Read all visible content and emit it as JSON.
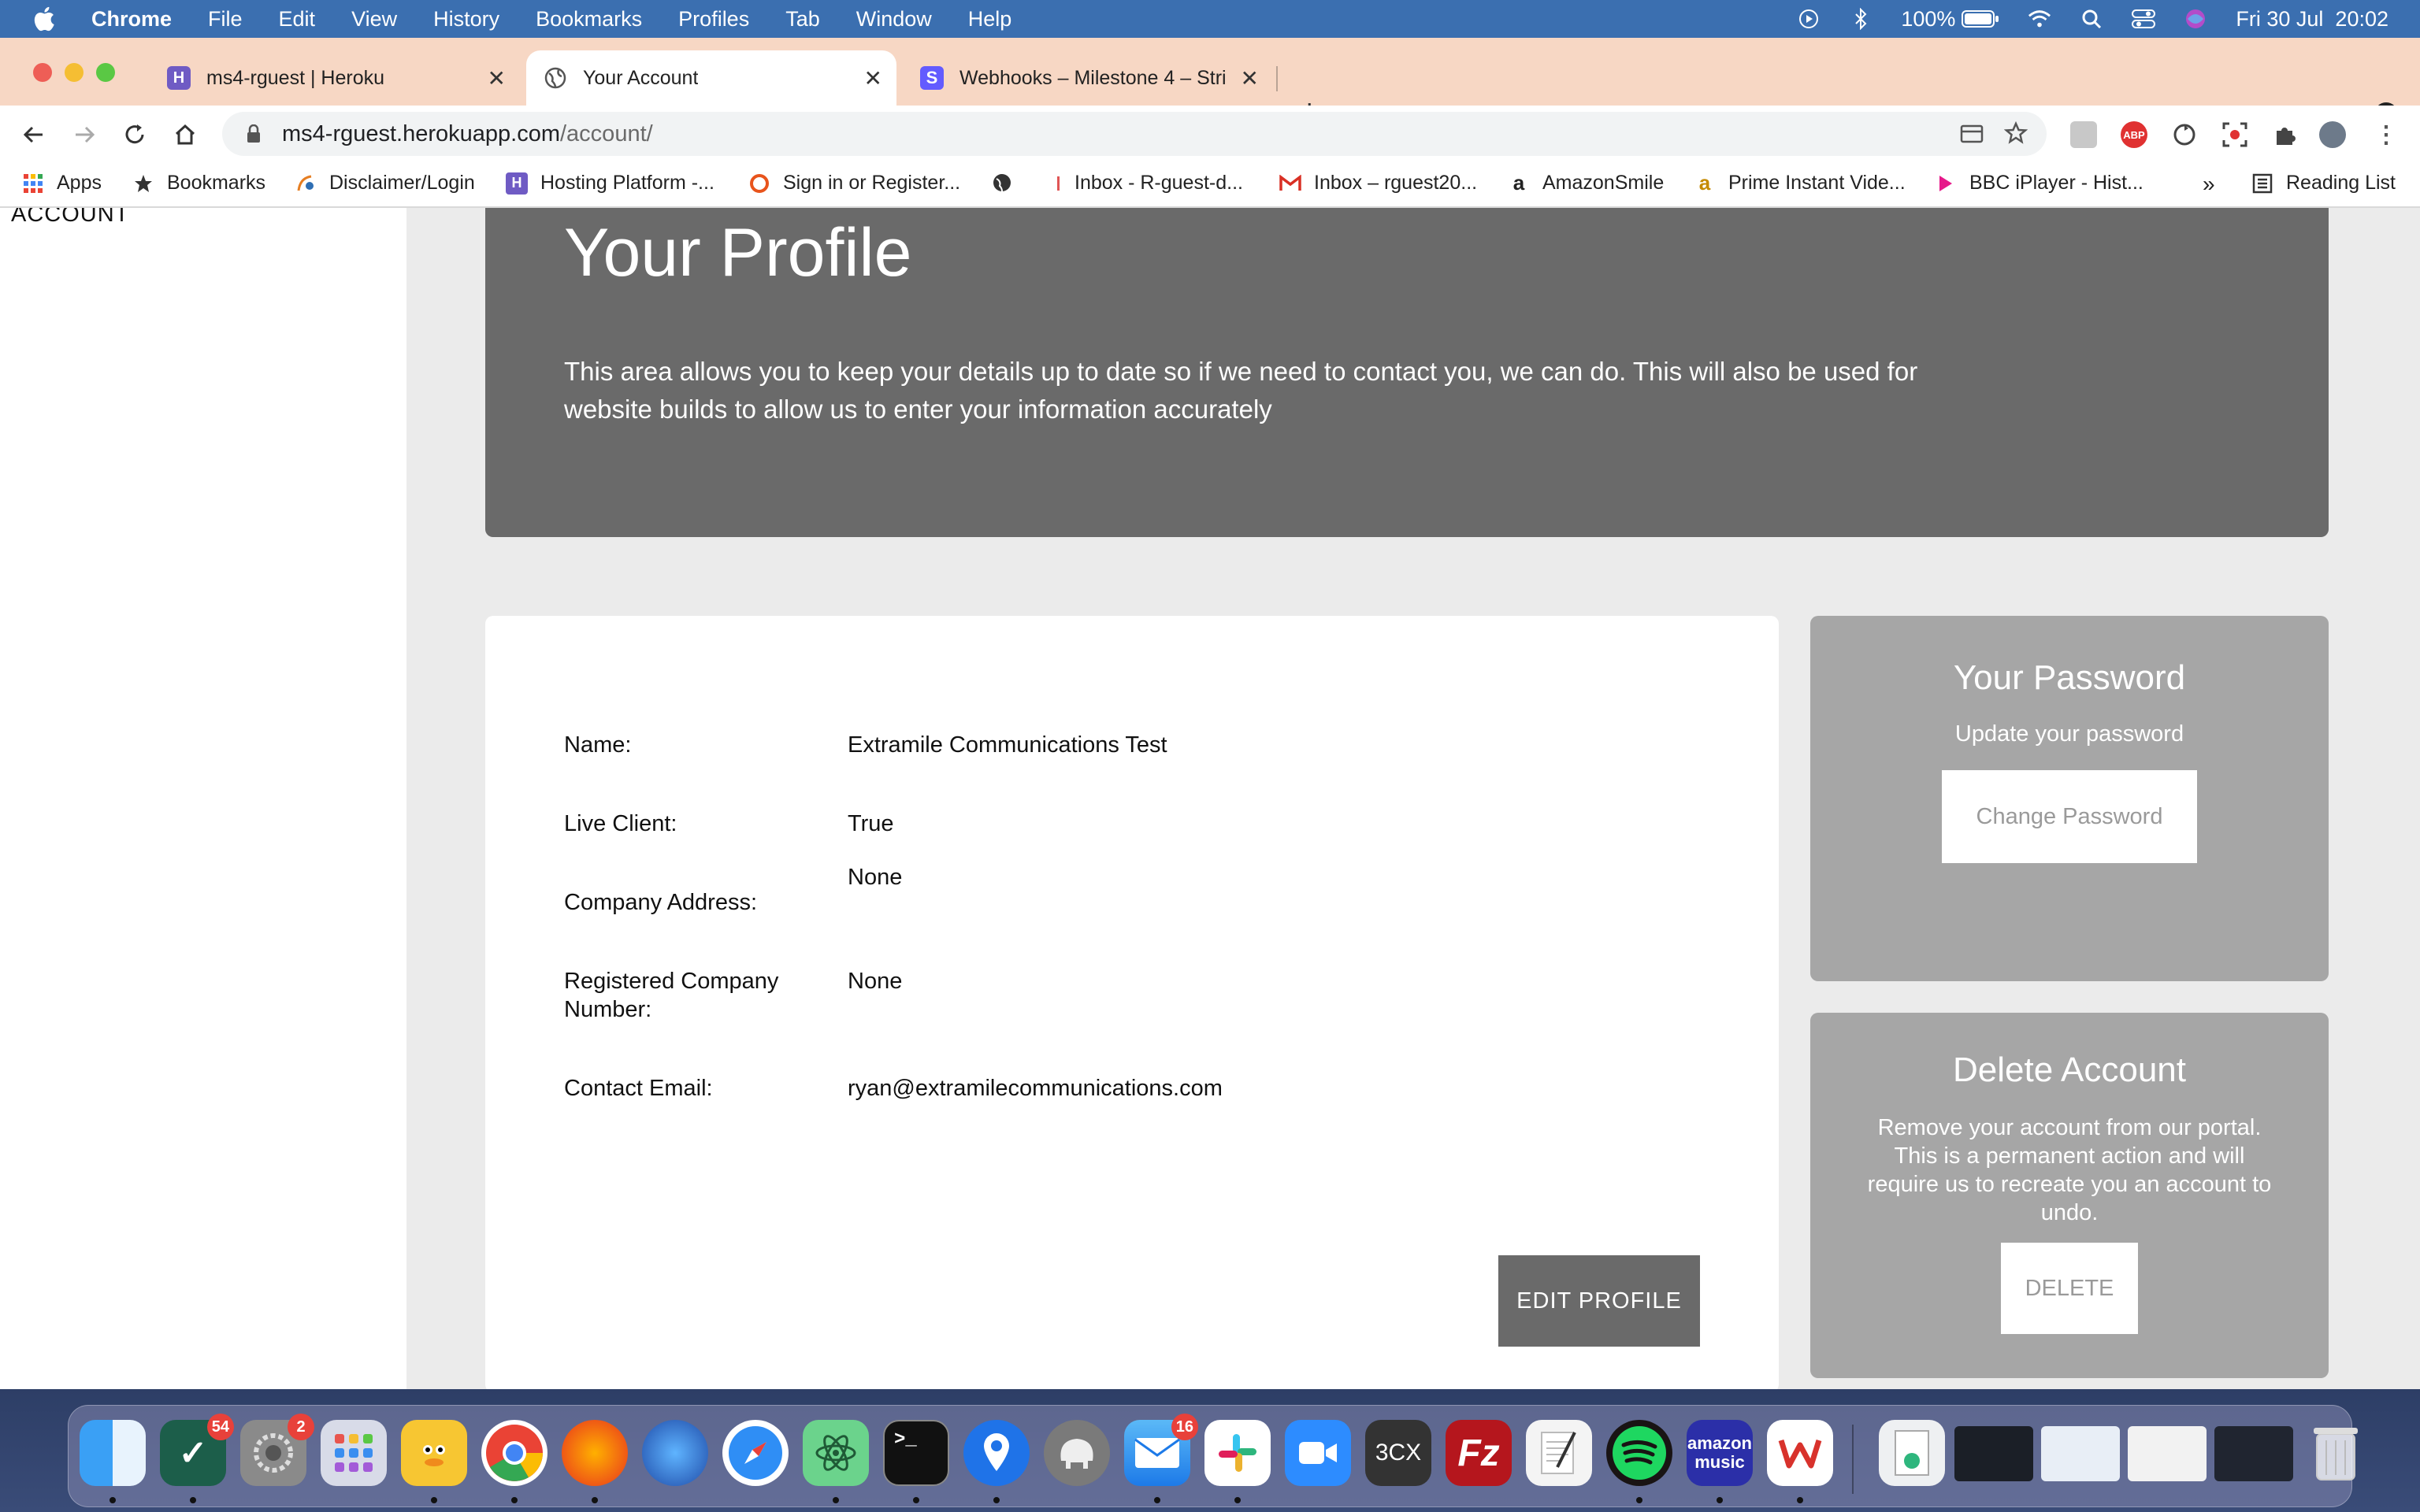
{
  "menubar": {
    "app_name": "Chrome",
    "items": [
      "File",
      "Edit",
      "View",
      "History",
      "Bookmarks",
      "Profiles",
      "Tab",
      "Window",
      "Help"
    ],
    "battery": "100%",
    "datetime": "Fri 30 Jul  20:02"
  },
  "tabs": [
    {
      "title": "ms4-rguest | Heroku",
      "icon": "heroku-icon",
      "active": false
    },
    {
      "title": "Your Account",
      "icon": "globe-icon",
      "active": true
    },
    {
      "title": "Webhooks – Milestone 4 – Stri",
      "icon": "stripe-icon",
      "active": false
    }
  ],
  "omnibox": {
    "url_host": "ms4-rguest.herokuapp.com",
    "url_path": "/account/"
  },
  "bookmarks": [
    {
      "label": "Apps",
      "icon": "apps-grid-icon"
    },
    {
      "label": "Bookmarks",
      "icon": "star-icon"
    },
    {
      "label": "Disclaimer/Login",
      "icon": "disclaimer-icon"
    },
    {
      "label": "Hosting Platform -...",
      "icon": "heroku-icon"
    },
    {
      "label": "Sign in or Register...",
      "icon": "circle-icon"
    },
    {
      "label": "",
      "icon": "globe-icon"
    },
    {
      "label": "Inbox - R-guest-d...",
      "icon": "mail-icon"
    },
    {
      "label": "Inbox – rguest20...",
      "icon": "gmail-icon"
    },
    {
      "label": "AmazonSmile",
      "icon": "amazon-icon"
    },
    {
      "label": "Prime Instant Vide...",
      "icon": "amazon-icon"
    },
    {
      "label": "BBC iPlayer - Hist...",
      "icon": "iplayer-icon"
    }
  ],
  "bookmarks_overflow": "»",
  "reading_list": "Reading List",
  "sidebar": {
    "account_label": "ACCOUNT"
  },
  "hero": {
    "title": "Your Profile",
    "description": "This area allows you to keep your details up to date so if we need to contact you, we can do. This will also be used for website builds to allow us to enter your information accurately"
  },
  "profile": {
    "name_label": "Name:",
    "name_value": "Extramile Communications Test",
    "live_label": "Live Client:",
    "live_value": "True",
    "address_label": "Company Address:",
    "address_value": "None",
    "regnum_label": "Registered Company Number:",
    "regnum_value": "None",
    "email_label": "Contact Email:",
    "email_value": "ryan@extramilecommunications.com",
    "edit_button": "EDIT PROFILE"
  },
  "password_card": {
    "title": "Your Password",
    "subtitle": "Update your password",
    "button": "Change Password"
  },
  "delete_card": {
    "title": "Delete Account",
    "description": "Remove your account from our portal. This is a permanent action and will require us to recreate you an account to undo.",
    "button": "DELETE"
  },
  "dock": {
    "badges": {
      "tasks": "54",
      "settings": "2",
      "mail": "16"
    },
    "labels": {
      "threecx": "3CX",
      "amazon_music": "amazon music"
    }
  },
  "colors": {
    "hero_bg": "#6a6a6a",
    "side_card_bg": "#a6a6a6",
    "page_bg": "#ebebeb",
    "tabstrip_bg": "#f7d7c4"
  }
}
